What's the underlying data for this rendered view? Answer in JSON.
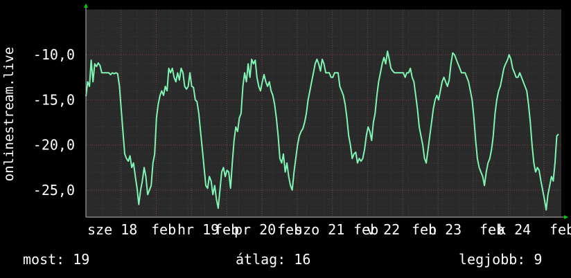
{
  "chart_data": {
    "type": "line",
    "ylabel": "onlinestream.live",
    "ylim": [
      -28,
      -5
    ],
    "yticks": [
      -10,
      -15,
      -20,
      -25
    ],
    "ytick_labels": [
      "-10,0",
      "-15,0",
      "-20,0",
      "-25,0"
    ],
    "xtick_labels": [
      "sze 18",
      "feb",
      "hr 19",
      "feb",
      "pr 20",
      "feb",
      "szo 21",
      "feb",
      "v 22",
      "feb",
      "h 23",
      "feb",
      "k 24",
      "feb"
    ],
    "colors": {
      "line": "#7ef5b4",
      "background": "#2a2a2a",
      "grid": "#555555",
      "axis_arrow": "#00cc00"
    },
    "series": [
      {
        "values": [
          -14.6,
          -13.0,
          -13.5,
          -10.6,
          -13.0,
          -11.0,
          -11.3,
          -10.9,
          -11.2,
          -12.0,
          -12.0,
          -12.0,
          -12.0,
          -12.0,
          -12.2,
          -12.0,
          -12.1,
          -12.0,
          -12.1,
          -13.5,
          -16.0,
          -18.5,
          -21.0,
          -21.5,
          -21.8,
          -21.2,
          -22.5,
          -22.0,
          -23.5,
          -24.8,
          -26.6,
          -25.0,
          -24.0,
          -22.5,
          -23.5,
          -25.5,
          -25.0,
          -24.5,
          -22.0,
          -21.0,
          -17.0,
          -15.5,
          -14.5,
          -14.0,
          -14.5,
          -13.5,
          -14.0,
          -11.5,
          -12.0,
          -11.5,
          -12.5,
          -13.0,
          -12.0,
          -12.8,
          -11.5,
          -12.0,
          -13.5,
          -13.8,
          -13.5,
          -12.0,
          -13.5,
          -13.6,
          -15.0,
          -15.2,
          -16.5,
          -18.5,
          -20.5,
          -22.5,
          -24.5,
          -24.8,
          -23.5,
          -24.0,
          -25.5,
          -24.5,
          -26.0,
          -27.0,
          -25.0,
          -23.0,
          -22.5,
          -23.5,
          -22.8,
          -23.0,
          -24.8,
          -22.0,
          -19.5,
          -18.0,
          -18.5,
          -17.0,
          -16.5,
          -13.5,
          -12.0,
          -13.0,
          -11.0,
          -12.5,
          -10.5,
          -11.0,
          -10.6,
          -12.5,
          -13.5,
          -14.0,
          -13.0,
          -12.2,
          -13.0,
          -13.5,
          -13.0,
          -14.0,
          -14.5,
          -15.5,
          -17.0,
          -19.0,
          -21.5,
          -22.0,
          -21.0,
          -23.0,
          -22.0,
          -23.5,
          -24.5,
          -25.0,
          -23.0,
          -21.5,
          -20.0,
          -19.0,
          -18.5,
          -18.2,
          -17.5,
          -16.5,
          -15.0,
          -14.0,
          -13.0,
          -12.0,
          -11.0,
          -10.5,
          -11.0,
          -11.8,
          -10.5,
          -11.0,
          -12.0,
          -12.0,
          -12.0,
          -12.5,
          -12.5,
          -12.0,
          -12.0,
          -12.0,
          -13.5,
          -14.0,
          -14.5,
          -15.5,
          -17.0,
          -19.0,
          -20.0,
          -21.5,
          -21.0,
          -20.8,
          -22.0,
          -21.5,
          -21.8,
          -21.5,
          -20.5,
          -19.0,
          -18.0,
          -18.5,
          -19.5,
          -17.5,
          -16.5,
          -14.5,
          -13.0,
          -12.0,
          -11.0,
          -10.3,
          -11.0,
          -9.6,
          -10.5,
          -11.5,
          -11.8,
          -12.0,
          -12.0,
          -12.0,
          -12.0,
          -12.0,
          -12.0,
          -12.5,
          -12.0,
          -12.0,
          -11.5,
          -12.5,
          -13.0,
          -14.5,
          -16.0,
          -18.0,
          -19.0,
          -20.0,
          -21.5,
          -22.0,
          -20.5,
          -19.0,
          -17.5,
          -16.0,
          -15.0,
          -14.5,
          -15.0,
          -14.0,
          -13.0,
          -12.5,
          -13.0,
          -13.5,
          -12.8,
          -11.0,
          -9.8,
          -10.0,
          -10.5,
          -11.0,
          -11.5,
          -12.0,
          -12.0,
          -12.0,
          -12.5,
          -13.0,
          -14.0,
          -15.0,
          -17.0,
          -19.5,
          -21.5,
          -22.5,
          -23.0,
          -23.5,
          -24.5,
          -23.0,
          -22.0,
          -21.5,
          -20.5,
          -19.0,
          -16.5,
          -15.0,
          -14.0,
          -13.5,
          -12.5,
          -11.5,
          -11.0,
          -10.6,
          -10.0,
          -10.5,
          -11.5,
          -12.0,
          -12.5,
          -12.5,
          -12.0,
          -12.5,
          -13.0,
          -13.5,
          -14.0,
          -15.5,
          -17.5,
          -20.0,
          -22.0,
          -23.0,
          -22.5,
          -22.8,
          -24.0,
          -25.0,
          -26.0,
          -27.2,
          -25.5,
          -24.5,
          -23.5,
          -24.0,
          -22.0,
          -19.0,
          -18.8
        ]
      }
    ],
    "stats": {
      "current": "most: 19",
      "average": "átlag: 16",
      "best": "legjobb: 9"
    }
  }
}
